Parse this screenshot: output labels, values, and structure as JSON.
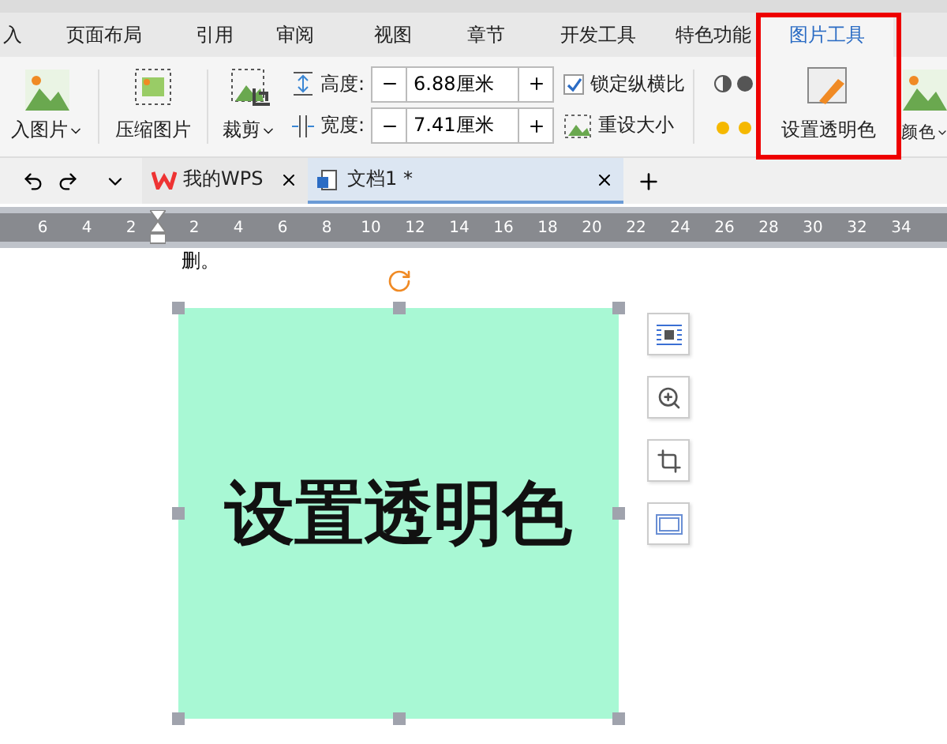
{
  "menu_tabs": [
    {
      "label": "入",
      "selected": false
    },
    {
      "label": "页面布局",
      "selected": false
    },
    {
      "label": "引用",
      "selected": false
    },
    {
      "label": "审阅",
      "selected": false
    },
    {
      "label": "视图",
      "selected": false
    },
    {
      "label": "章节",
      "selected": false
    },
    {
      "label": "开发工具",
      "selected": false
    },
    {
      "label": "特色功能",
      "selected": false
    },
    {
      "label": "图片工具",
      "selected": true
    }
  ],
  "ribbon": {
    "insert_picture": {
      "label": "入图片"
    },
    "compress": {
      "label": "压缩图片"
    },
    "crop": {
      "label": "裁剪"
    },
    "size_fields": [
      {
        "label": "高度:",
        "value": "6.88厘米"
      },
      {
        "label": "宽度:",
        "value": "7.41厘米"
      }
    ],
    "lock_ratio": {
      "label": "锁定纵横比",
      "checked": true
    },
    "reset_size": {
      "label": "重设大小"
    },
    "set_transparent": {
      "label": "设置透明色",
      "highlighted": true
    },
    "color": {
      "label": "颜色"
    }
  },
  "doc_tabs": [
    {
      "label": "我的WPS",
      "selected": false
    },
    {
      "label": "文档1 *",
      "selected": true
    }
  ],
  "ruler": {
    "left_labels": [
      "6",
      "4",
      "2"
    ],
    "right_labels": [
      "2",
      "4",
      "6",
      "8",
      "10",
      "12",
      "14",
      "16",
      "18",
      "20",
      "22",
      "24",
      "26",
      "28",
      "30",
      "32",
      "34"
    ]
  },
  "document": {
    "text_fragment": "删。",
    "image_text": "设置透明色"
  }
}
